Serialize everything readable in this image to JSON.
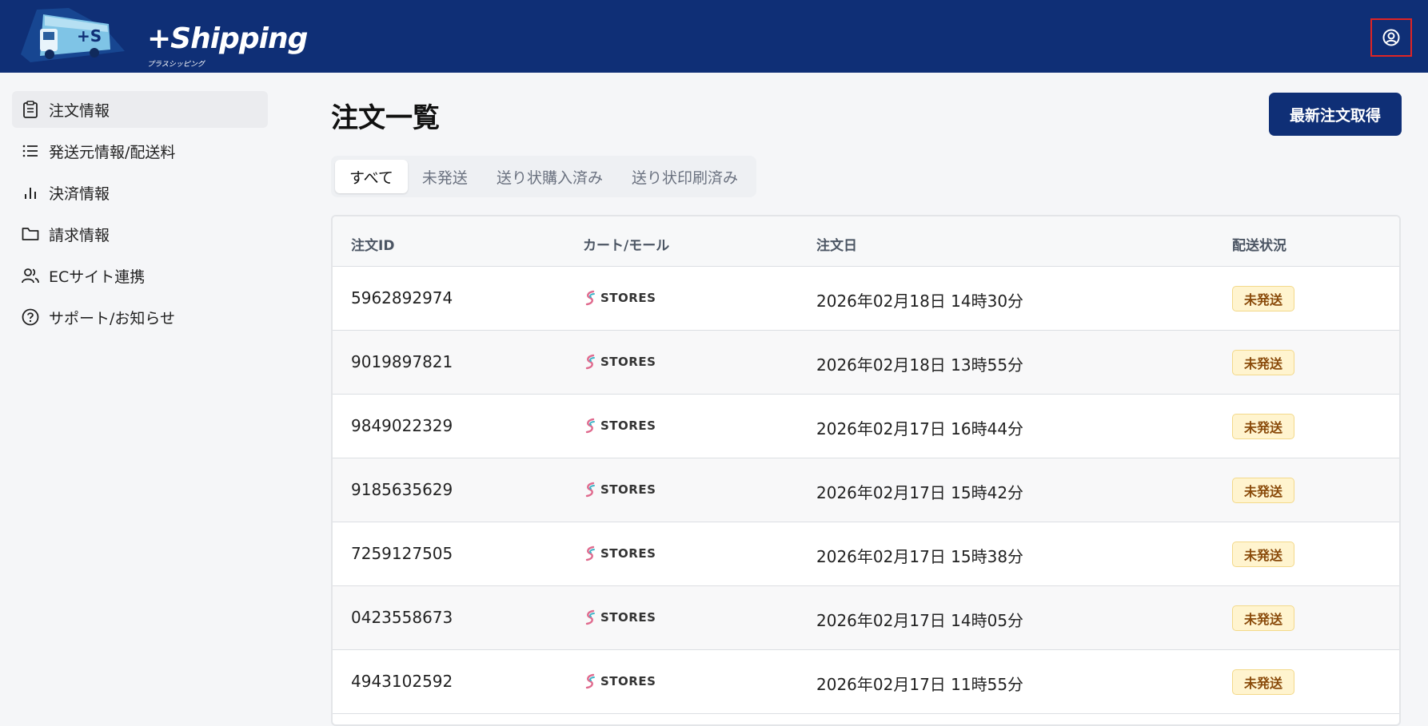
{
  "header": {
    "logo_text": "+Shipping",
    "logo_sub": "プラスシッピング",
    "account_icon": "user-circle-icon"
  },
  "sidebar": {
    "items": [
      {
        "label": "注文情報",
        "icon": "clipboard-icon",
        "active": true
      },
      {
        "label": "発送元情報/配送料",
        "icon": "list-icon",
        "active": false
      },
      {
        "label": "決済情報",
        "icon": "bar-chart-icon",
        "active": false
      },
      {
        "label": "請求情報",
        "icon": "folder-icon",
        "active": false
      },
      {
        "label": "ECサイト連携",
        "icon": "users-icon",
        "active": false
      },
      {
        "label": "サポート/お知らせ",
        "icon": "help-circle-icon",
        "active": false
      }
    ]
  },
  "main": {
    "title": "注文一覧",
    "fetch_button": "最新注文取得",
    "tabs": [
      {
        "label": "すべて",
        "active": true
      },
      {
        "label": "未発送",
        "active": false
      },
      {
        "label": "送り状購入済み",
        "active": false
      },
      {
        "label": "送り状印刷済み",
        "active": false
      }
    ],
    "table": {
      "headers": [
        "注文ID",
        "カート/モール",
        "注文日",
        "配送状況"
      ],
      "rows": [
        {
          "id": "5962892974",
          "cart": "STORES",
          "date": "2026年02月18日 14時30分",
          "status": "未発送"
        },
        {
          "id": "9019897821",
          "cart": "STORES",
          "date": "2026年02月18日 13時55分",
          "status": "未発送"
        },
        {
          "id": "9849022329",
          "cart": "STORES",
          "date": "2026年02月17日 16時44分",
          "status": "未発送"
        },
        {
          "id": "9185635629",
          "cart": "STORES",
          "date": "2026年02月17日 15時42分",
          "status": "未発送"
        },
        {
          "id": "7259127505",
          "cart": "STORES",
          "date": "2026年02月17日 15時38分",
          "status": "未発送"
        },
        {
          "id": "0423558673",
          "cart": "STORES",
          "date": "2026年02月17日 14時05分",
          "status": "未発送"
        },
        {
          "id": "4943102592",
          "cart": "STORES",
          "date": "2026年02月17日 11時55分",
          "status": "未発送"
        }
      ]
    }
  },
  "colors": {
    "header_bg": "#0f2f76",
    "badge_bg": "#fff4cf",
    "badge_text": "#8a4b0b"
  }
}
